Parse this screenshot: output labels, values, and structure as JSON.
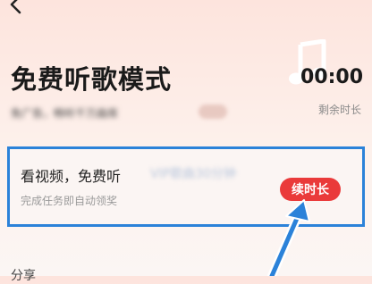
{
  "header": {
    "back_icon": "chevron-left-icon",
    "decor_icon": "music-note-icon",
    "title": "免费听歌模式",
    "subtitle": "免广告，畅听千万曲库"
  },
  "timer": {
    "value": "00:00",
    "label": "剩余时长"
  },
  "task": {
    "title": "看视频，免费听",
    "title_obscured": "VIP歌曲30分钟",
    "description": "完成任务即自动领奖",
    "button_label": "续时长"
  },
  "next_section": {
    "label": "分享"
  },
  "colors": {
    "accent": "#ea3a3a",
    "highlight": "#2b82d9"
  }
}
